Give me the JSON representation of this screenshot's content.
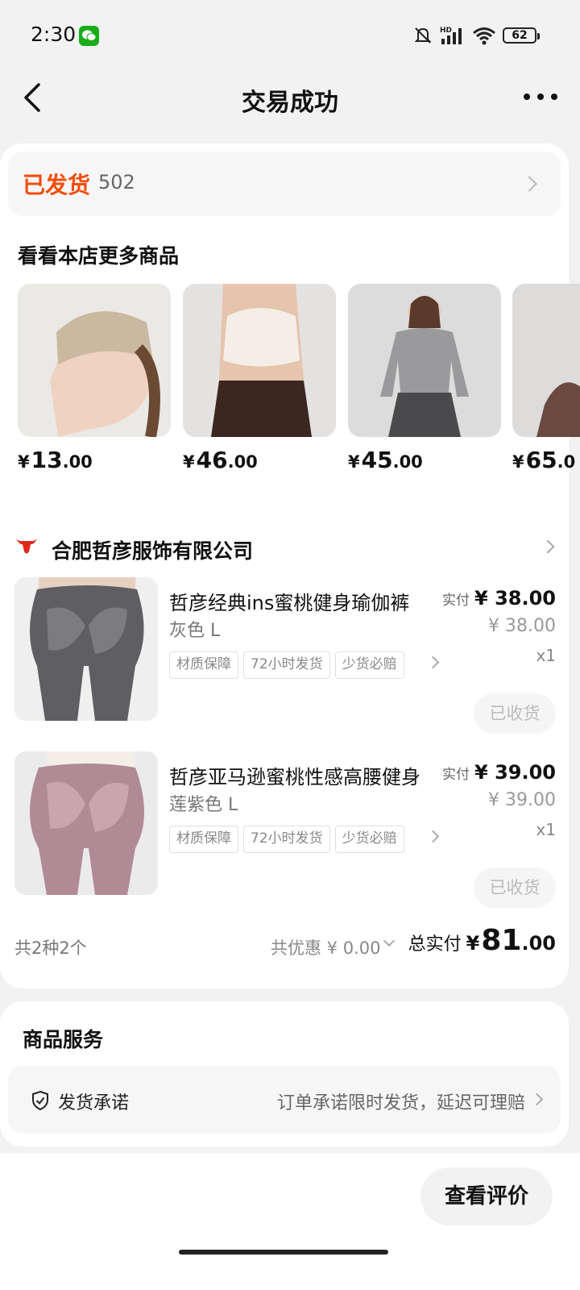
{
  "status_bar": {
    "time": "2:30",
    "battery": "62",
    "network": "HD"
  },
  "nav": {
    "title": "交易成功"
  },
  "shipping": {
    "status": "已发货",
    "code": "502"
  },
  "recommend": {
    "title": "看看本店更多商品",
    "items": [
      {
        "yen": "¥",
        "int": "13",
        "dec": ".00",
        "image": "headband-photo"
      },
      {
        "yen": "¥",
        "int": "46",
        "dec": ".00",
        "image": "sports-bra-photo"
      },
      {
        "yen": "¥",
        "int": "45",
        "dec": ".00",
        "image": "gray-long-sleeve-photo"
      },
      {
        "yen": "¥",
        "int": "65",
        "dec": ".0",
        "image": "brown-pants-photo"
      }
    ]
  },
  "shop": {
    "name": "合肥哲彦服饰有限公司"
  },
  "order_items": [
    {
      "title": "哲彦经典ins蜜桃健身瑜伽裤",
      "sku": "灰色 L",
      "tags": [
        "材质保障",
        "72小时发货",
        "少货必赔"
      ],
      "paid_label": "实付",
      "paid_price": "¥ 38.00",
      "orig_price": "¥ 38.00",
      "qty": "x1",
      "action": "已收货",
      "colors": {
        "pants": "#5f5f63",
        "pants_light": "#7b7b80"
      }
    },
    {
      "title": "哲彦亚马逊蜜桃性感高腰健身",
      "sku": "莲紫色 L",
      "tags": [
        "材质保障",
        "72小时发货",
        "少货必赔"
      ],
      "paid_label": "实付",
      "paid_price": "¥ 39.00",
      "orig_price": "¥ 39.00",
      "qty": "x1",
      "action": "已收货",
      "colors": {
        "pants": "#b08a95",
        "pants_light": "#c9a5ae"
      }
    }
  ],
  "summary": {
    "count": "共2种2个",
    "discount": "共优惠 ¥ 0.00",
    "total_label": "总实付",
    "total_yen": "¥",
    "total_int": "81",
    "total_dec": ".00"
  },
  "service": {
    "title": "商品服务",
    "name": "发货承诺",
    "desc": "订单承诺限时发货，延迟可理赔"
  },
  "review_button": "查看评价",
  "colors": {
    "accent": "#f24d0c",
    "background": "#f2f2f2",
    "card": "#ffffff"
  }
}
